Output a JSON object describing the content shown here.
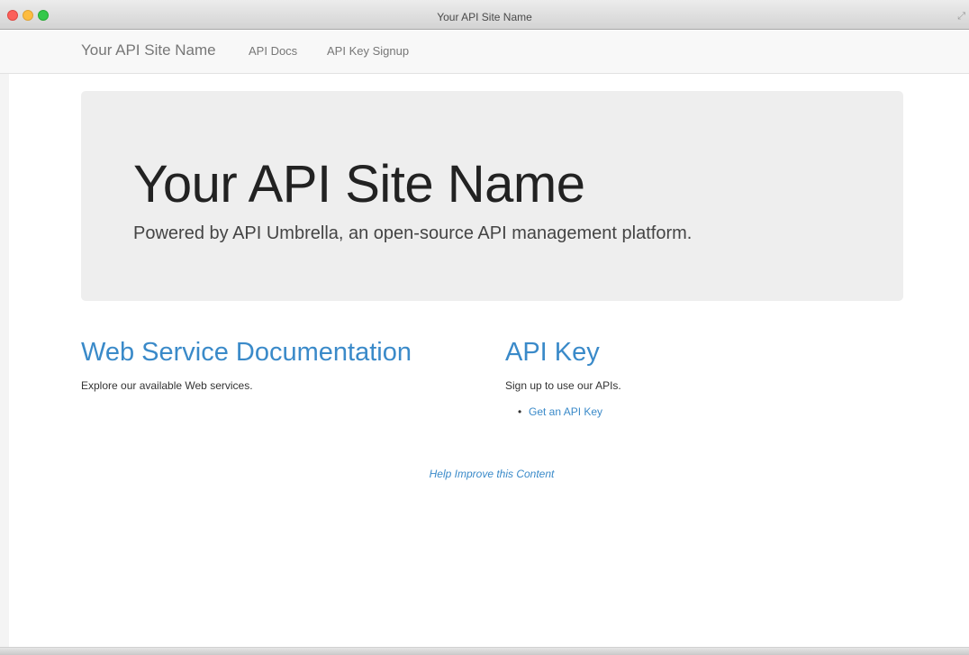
{
  "window": {
    "title": "Your API Site Name",
    "resize_glyph": "⤢"
  },
  "navbar": {
    "brand": "Your API Site Name",
    "links": [
      {
        "label": "API Docs"
      },
      {
        "label": "API Key Signup"
      }
    ]
  },
  "hero": {
    "title": "Your API Site Name",
    "subtitle": "Powered by API Umbrella, an open-source API management platform."
  },
  "docs_section": {
    "heading": "Web Service Documentation",
    "text": "Explore our available Web services."
  },
  "key_section": {
    "heading": "API Key",
    "text": "Sign up to use our APIs.",
    "bullet": "•",
    "link_label": "Get an API Key"
  },
  "footer": {
    "help_link": "Help Improve this Content"
  },
  "colors": {
    "accent": "#3a8ac9",
    "hero_bg": "#eeeeee",
    "navbar_bg": "#f8f8f8"
  },
  "icons": {
    "close": "close-icon",
    "minimize": "minimize-icon",
    "maximize": "maximize-icon",
    "resize": "fullscreen-icon"
  }
}
